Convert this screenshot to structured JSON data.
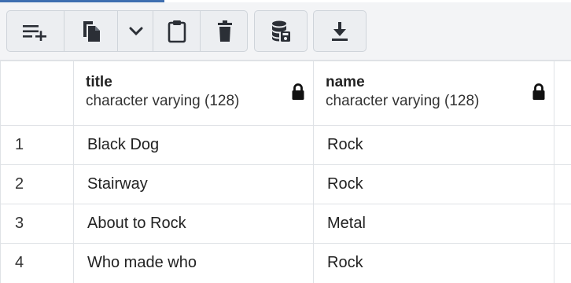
{
  "toolbar": {
    "buttons": [
      {
        "name": "add-row-button",
        "icon": "add-row-icon"
      },
      {
        "name": "copy-button",
        "icon": "copy-icon"
      },
      {
        "name": "copy-options-dropdown",
        "icon": "chevron-down-icon"
      },
      {
        "name": "paste-button",
        "icon": "clipboard-icon"
      },
      {
        "name": "delete-button",
        "icon": "trash-icon"
      },
      {
        "name": "save-data-button",
        "icon": "database-save-icon"
      },
      {
        "name": "download-button",
        "icon": "download-icon"
      }
    ]
  },
  "grid": {
    "columns": [
      {
        "name": "title",
        "type": "character varying (128)"
      },
      {
        "name": "name",
        "type": "character varying (128)"
      }
    ],
    "rows": [
      {
        "num": "1",
        "title": "Black Dog",
        "name": "Rock"
      },
      {
        "num": "2",
        "title": "Stairway",
        "name": "Rock"
      },
      {
        "num": "3",
        "title": "About to Rock",
        "name": "Metal"
      },
      {
        "num": "4",
        "title": "Who made who",
        "name": "Rock"
      }
    ]
  },
  "colors": {
    "accent": "#3f6fb0",
    "icon": "#2b2f36",
    "toolbar_bg": "#f3f4f6",
    "border": "#dfe2e6"
  }
}
